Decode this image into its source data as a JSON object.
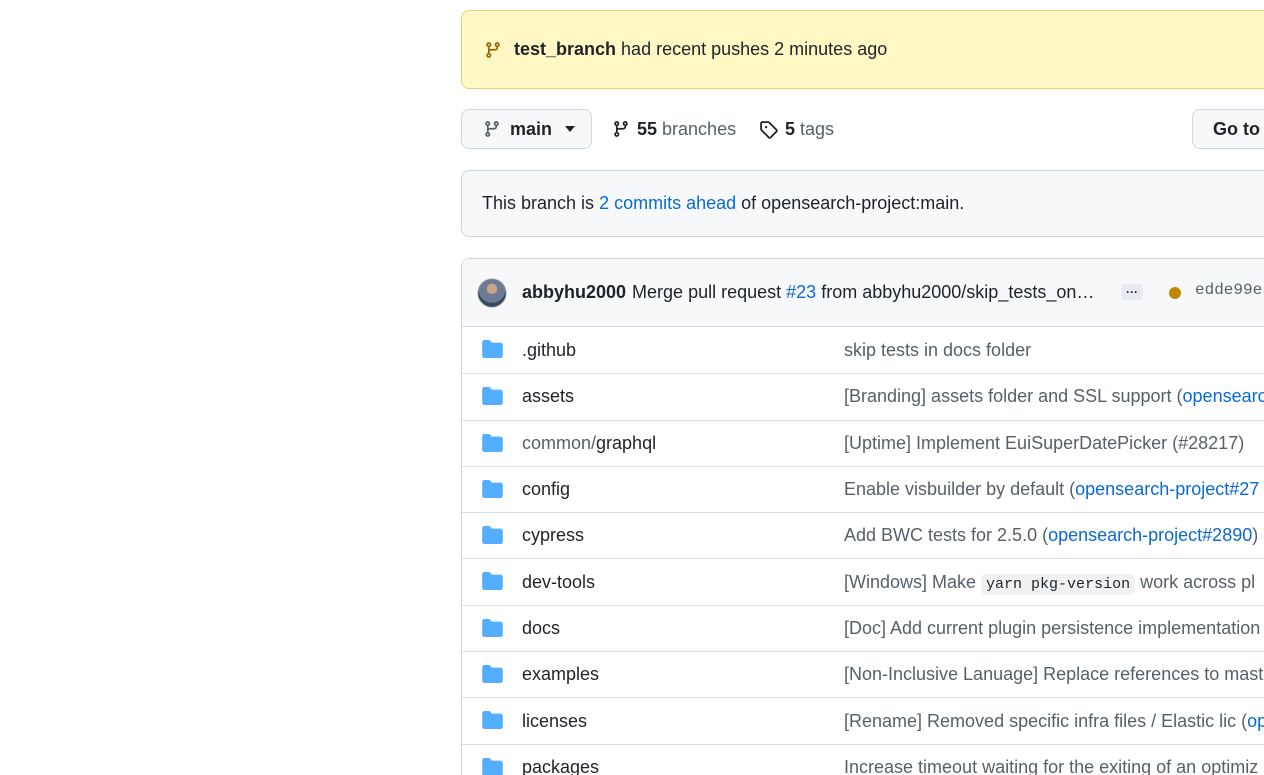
{
  "flash": {
    "branch": "test_branch",
    "message": "had recent pushes 2 minutes ago",
    "icon": "git-branch-icon"
  },
  "toolbar": {
    "branch_selected": "main",
    "branches_count": "55",
    "branches_label": "branches",
    "tags_count": "5",
    "tags_label": "tags",
    "goto_file_label": "Go to file"
  },
  "ahead": {
    "prefix": "This branch is",
    "link": "2 commits ahead",
    "suffix": "of opensearch-project:main."
  },
  "commit": {
    "author": "abbyhu2000",
    "message_start": "Merge pull request",
    "pr_link": "#23",
    "message_end": "from abbyhu2000/skip_tests_on…",
    "ellipsis": "···",
    "sha": "edde99e",
    "status_color": "#bf8700"
  },
  "files": [
    {
      "name": ".github",
      "msg": "skip tests in docs folder"
    },
    {
      "name": "assets",
      "msg": "[Branding] assets folder and SSL support (",
      "link": "opensearc"
    },
    {
      "name_prefix": "common/",
      "name": "graphql",
      "msg": "[Uptime] Implement EuiSuperDatePicker (#28217)"
    },
    {
      "name": "config",
      "msg": "Enable visbuilder by default (",
      "link": "opensearch-project#27"
    },
    {
      "name": "cypress",
      "msg": "Add BWC tests for 2.5.0 (",
      "link": "opensearch-project#2890",
      "msg_end": ")"
    },
    {
      "name": "dev-tools",
      "msg": "[Windows] Make ",
      "code": "yarn pkg-version",
      "msg_end": " work across pl"
    },
    {
      "name": "docs",
      "msg": "[Doc] Add current plugin persistence implementation"
    },
    {
      "name": "examples",
      "msg": "[Non-Inclusive Lanuage] Replace references to mast"
    },
    {
      "name": "licenses",
      "msg": "[Rename] Removed specific infra files / Elastic lic (",
      "link": "op"
    },
    {
      "name": "packages",
      "msg": "Increase timeout waiting for the exiting of an optimiz"
    }
  ]
}
